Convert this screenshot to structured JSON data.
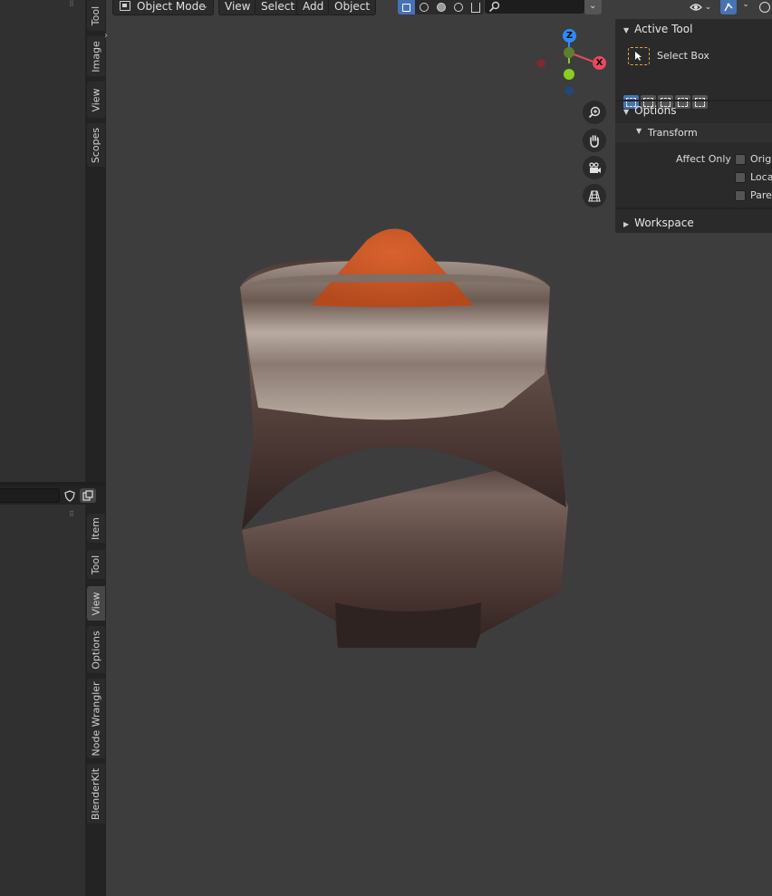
{
  "header": {
    "mode": "Object Mode",
    "menus": [
      "View",
      "Select",
      "Add",
      "Object"
    ]
  },
  "left_top_tabs": [
    "Tool",
    "Image",
    "View",
    "Scopes"
  ],
  "left_bottom_tabs": [
    "Item",
    "Tool",
    "View",
    "Options",
    "Node Wrangler",
    "BlenderKit"
  ],
  "gizmo": {
    "z": "Z",
    "x": "X"
  },
  "npanel": {
    "active_tool_title": "Active Tool",
    "tool_name": "Select Box",
    "options_title": "Options",
    "transform_title": "Transform",
    "affect_only_label": "Affect Only",
    "affect_items": [
      "Origi",
      "Loca",
      "Parer"
    ],
    "workspace_title": "Workspace"
  },
  "colors": {
    "accent": "#4772b3",
    "axis_x": "#e84a5f",
    "axis_y": "#8ccc1f",
    "axis_z": "#2e8bff"
  }
}
